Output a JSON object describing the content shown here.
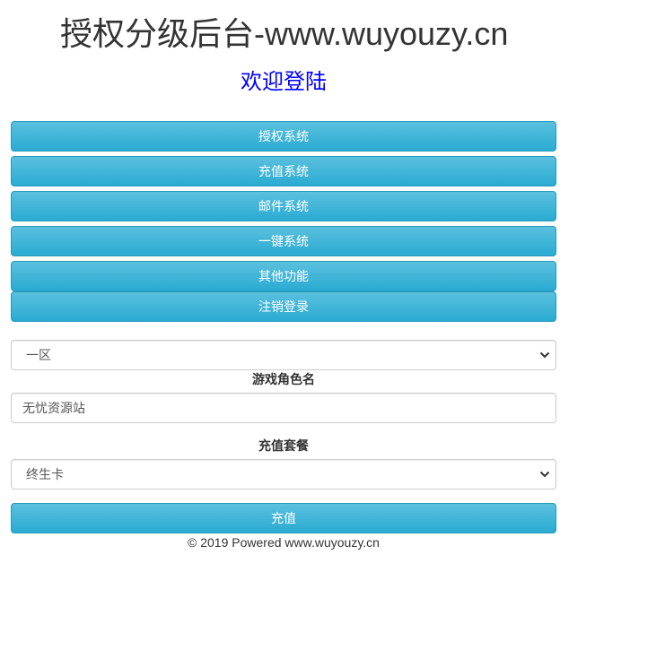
{
  "header": {
    "site_title": "授权分级后台-www.wuyouzy.cn",
    "welcome": "欢迎登陆"
  },
  "menu": {
    "items": [
      {
        "label": "授权系统"
      },
      {
        "label": "充值系统"
      },
      {
        "label": "邮件系统"
      },
      {
        "label": "一键系统"
      },
      {
        "label": "其他功能"
      },
      {
        "label": "注销登录"
      }
    ]
  },
  "form": {
    "server_select": {
      "selected": "一区"
    },
    "role_label": "游戏角色名",
    "role_input": {
      "value": "无忧资源站"
    },
    "package_label": "充值套餐",
    "package_select": {
      "selected": "终生卡"
    },
    "submit_label": "充值"
  },
  "footer": {
    "text": "© 2019 Powered www.wuyouzy.cn"
  },
  "colors": {
    "button_top": "#5bc0de",
    "button_bottom": "#2aabd2",
    "welcome": "#0000ff"
  }
}
